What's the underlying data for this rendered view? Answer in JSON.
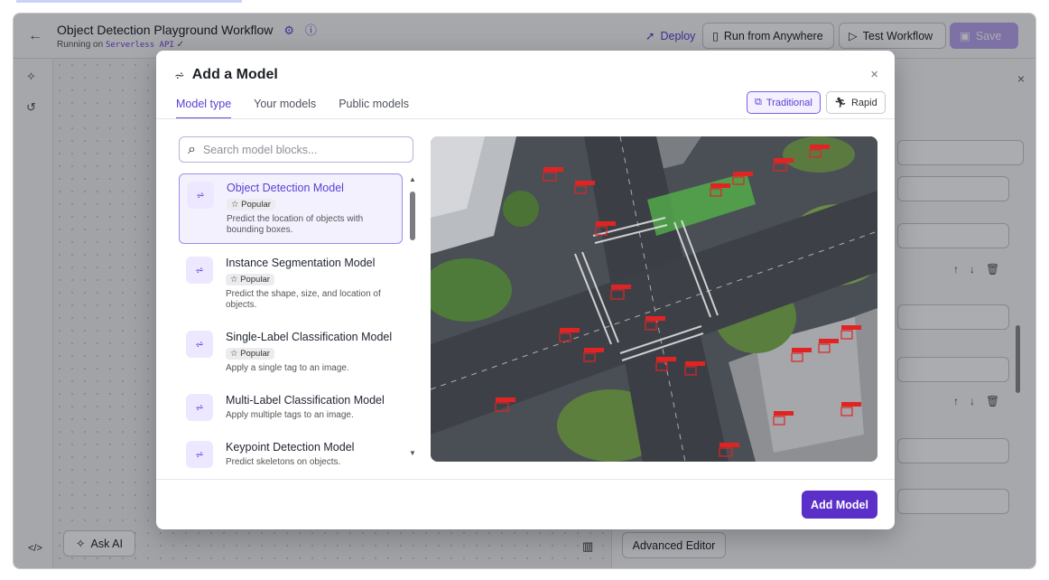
{
  "header": {
    "title": "Object Detection Playground Workflow",
    "subtitle_prefix": "Running on",
    "subtitle_mono": "Serverless API",
    "deploy_label": "Deploy",
    "run_anywhere_label": "Run from Anywhere",
    "test_workflow_label": "Test Workflow",
    "save_label": "Save"
  },
  "canvas": {
    "ask_ai_label": "Ask AI"
  },
  "right_panel": {
    "advanced_editor_label": "Advanced Editor"
  },
  "modal": {
    "title": "Add a Model",
    "tabs": [
      {
        "label": "Model type",
        "active": true
      },
      {
        "label": "Your models",
        "active": false
      },
      {
        "label": "Public models",
        "active": false
      }
    ],
    "mode_traditional": "Traditional",
    "mode_rapid": "Rapid",
    "search_placeholder": "Search model blocks...",
    "models": [
      {
        "name": "Object Detection Model",
        "badge": "Popular",
        "description": "Predict the location of objects with bounding boxes.",
        "selected": true
      },
      {
        "name": "Instance Segmentation Model",
        "badge": "Popular",
        "description": "Predict the shape, size, and location of objects.",
        "selected": false
      },
      {
        "name": "Single-Label Classification Model",
        "badge": "Popular",
        "description": "Apply a single tag to an image.",
        "selected": false
      },
      {
        "name": "Multi-Label Classification Model",
        "badge": "",
        "description": "Apply multiple tags to an image.",
        "selected": false
      },
      {
        "name": "Keypoint Detection Model",
        "badge": "",
        "description": "Predict skeletons on objects.",
        "selected": false
      }
    ],
    "add_button_label": "Add Model"
  },
  "colors": {
    "accent": "#5b3fd3",
    "primary_button": "#5b30c9",
    "save_disabled": "#b9a6f2",
    "detection_box": "#e02424"
  }
}
